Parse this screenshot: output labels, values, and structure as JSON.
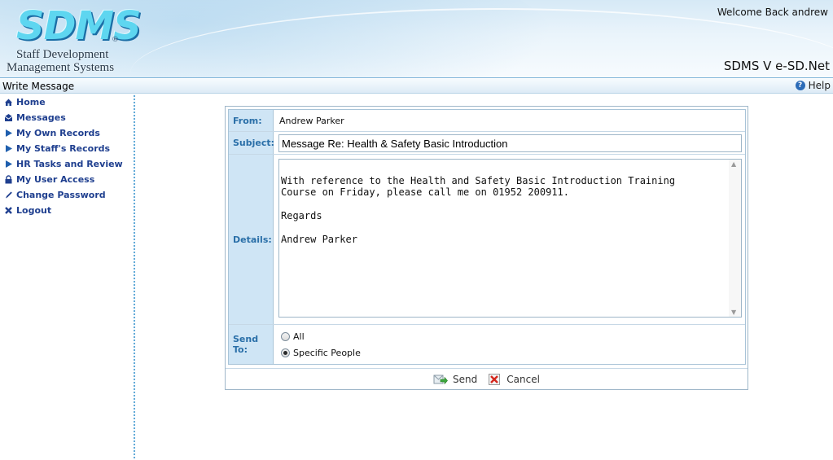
{
  "header": {
    "logo_mark": "SDMS",
    "logo_reg": "®",
    "logo_line1": "Staff Development",
    "logo_line2": "Management Systems",
    "welcome": "Welcome Back andrew",
    "product": "SDMS V e-SD.Net"
  },
  "titlebar": {
    "title": "Write Message",
    "help": "Help"
  },
  "sidebar": {
    "items": [
      {
        "label": "Home",
        "icon": "home-icon"
      },
      {
        "label": "Messages",
        "icon": "messages-icon"
      },
      {
        "label": "My Own Records",
        "icon": "play-arrow-icon"
      },
      {
        "label": "My Staff's Records",
        "icon": "play-arrow-icon"
      },
      {
        "label": "HR Tasks and Review",
        "icon": "play-arrow-icon"
      },
      {
        "label": "My User Access",
        "icon": "lock-icon"
      },
      {
        "label": "Change Password",
        "icon": "pen-icon"
      },
      {
        "label": "Logout",
        "icon": "x-icon"
      }
    ]
  },
  "form": {
    "from_label": "From:",
    "from_value": "Andrew Parker",
    "subject_label": "Subject:",
    "subject_value": "Message Re: Health & Safety Basic Introduction",
    "details_label": "Details:",
    "details_value": "\nWith reference to the Health and Safety Basic Introduction Training\nCourse on Friday, please call me on 01952 200911.\n\nRegards\n\nAndrew Parker",
    "sendto_label": "Send To:",
    "sendto_options": [
      {
        "label": "All",
        "selected": false
      },
      {
        "label": "Specific People",
        "selected": true
      }
    ]
  },
  "actions": {
    "send_label": "Send",
    "cancel_label": "Cancel"
  },
  "colors": {
    "nav_text": "#1f3f8f",
    "label_bg": "#cfe5f5",
    "label_text": "#2a6fa8",
    "logo_cyan": "#5ed6f0"
  }
}
